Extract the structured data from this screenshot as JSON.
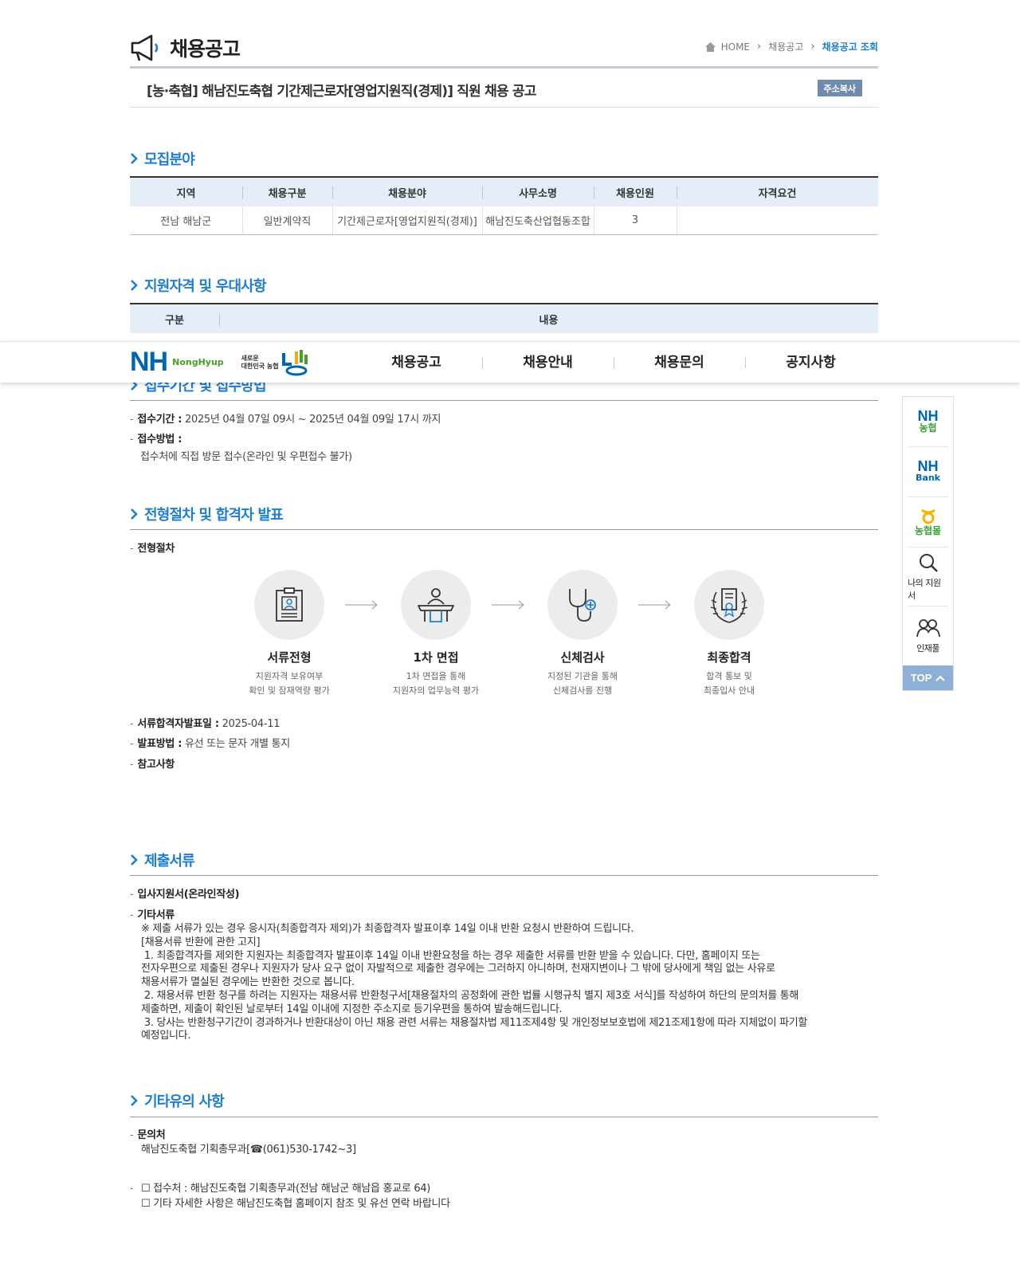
{
  "page": {
    "title": "채용공고",
    "breadcrumb": [
      "HOME",
      "채용공고",
      "채용공고 조회"
    ],
    "notice_title": "[농·축협] 해남진도축협 기간제근로자[영업지원직(경제)] 직원 채용 공고",
    "copy_button": "주소복사"
  },
  "nav": {
    "brand": "NH",
    "brand_sub": "NongHyup",
    "slogan_line1": "새로운",
    "slogan_line2": "대한민국 농협",
    "items": [
      "채용공고",
      "채용안내",
      "채용문의",
      "공지사항"
    ]
  },
  "quick": {
    "items": [
      {
        "top": "NH",
        "sub": "농협"
      },
      {
        "top": "NH",
        "sub": "Bank"
      },
      {
        "top": "",
        "sub": "농협몰"
      },
      {
        "label": "나의 지원서"
      },
      {
        "label": "인재풀"
      }
    ],
    "top_button": "TOP"
  },
  "recruit": {
    "heading": "모집분야",
    "columns": [
      "지역",
      "채용구분",
      "채용분야",
      "사무소명",
      "채용인원",
      "자격요건"
    ],
    "rows": [
      [
        "전남 해남군",
        "일반계약직",
        "기간제근로자[영업지원직(경제)]",
        "해남진도축산업협동조합",
        "3",
        ""
      ]
    ]
  },
  "qualification": {
    "heading": "지원자격 및 우대사항",
    "columns": [
      "구분",
      "내용"
    ]
  },
  "reception": {
    "heading": "접수기간 및 접수방법",
    "period_label": "접수기간 :",
    "period_value": "2025년 04월 07일 09시 ~ 2025년 04월 09일 17시 까지",
    "method_label": "접수방법 :",
    "method_value": "접수처에 직접 방문 접수(온라인 및 우편접수 불가)"
  },
  "process": {
    "heading": "전형절차 및 합격자 발표",
    "sub_label": "전형절차",
    "steps": [
      {
        "title": "서류전형",
        "desc": "지원자격 보유여부\n확인 및 잠재역량 평가"
      },
      {
        "title": "1차 면접",
        "desc": "1차 면접을 통해\n지원자의 업무능력 평가"
      },
      {
        "title": "신체검사",
        "desc": "지정된 기관을 통해\n신체검사를 진행"
      },
      {
        "title": "최종합격",
        "desc": "합격 통보 및\n최종입사 안내"
      }
    ],
    "announce_label": "서류합격자발표일 :",
    "announce_value": "2025-04-11",
    "method_label": "발표방법 :",
    "method_value": "유선 또는 문자 개별 통지",
    "notes_label": "참고사항"
  },
  "documents": {
    "heading": "제출서류",
    "item1": "입사지원서(온라인작성)",
    "item2": "기타서류",
    "text": "※ 제출 서류가 있는 경우 응시자(최종합격자 제외)가 최종합격자 발표이후 14일 이내 반환 요청시 반환하여 드립니다.\n[채용서류 반환에 관한 고지]\n 1. 최종합격자를 제외한 지원자는 최종합격자 발표이후 14일 이내 반환요청을 하는 경우 제출한 서류를 반환 받을 수 있습니다. 다만, 홈페이지 또는\n전자우편으로 제출된 경우나 지원자가 당사 요구 없이 자발적으로 제출한 경우에는 그러하지 아니하며, 천재지변이나 그 밖에 당사에게 책임 없는 사유로\n채용서류가 멸실된 경우에는 반환한 것으로 봅니다.\n 2. 채용서류 반환 청구를 하려는 지원자는 채용서류 반환청구서[채용절차의 공정화에 관한 법률 시행규칙 별지 제3호 서식]를 작성하여 하단의 문의처를 통해\n제출하면, 제출이 확인된 날로부터 14일 이내에 지정한 주소지로 등기우편을 통하여 발송해드립니다.\n 3. 당사는 반환청구기간이 경과하거나 반환대상이 아닌 채용 관련 서류는 채용절차법 제11조제4항 및 개인정보보호법에 제21조제1항에 따라 지체없이 파기할\n예정입니다."
  },
  "etc": {
    "heading": "기타유의 사항",
    "contact_label": "문의처",
    "contact_value": "해남진도축협 기획총무과[☎(061)530-1742~3]",
    "note_line1": "☐ 접수처 : 해남진도축협 기획총무과(전남 해남군 해남읍 홍교로 64)",
    "note_line2": "☐ 기타 자세한 사항은 해남진도축협 홈페이지 참조 및 유선 연락 바랍니다"
  },
  "colors": {
    "accent": "#1d7ed4",
    "header_bg": "#e5eef8",
    "brand": "#0066b3",
    "top_btn": "#8fb0d6"
  }
}
